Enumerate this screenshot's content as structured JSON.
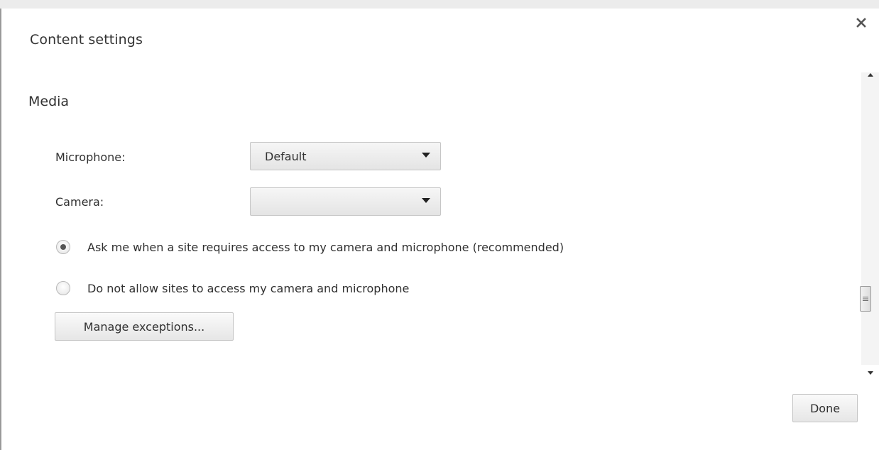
{
  "dialog": {
    "title": "Content settings",
    "close_icon": "close-icon"
  },
  "media": {
    "heading": "Media",
    "microphone": {
      "label": "Microphone:",
      "selected": "Default"
    },
    "camera": {
      "label": "Camera:",
      "selected": ""
    },
    "options": [
      {
        "label": "Ask me when a site requires access to my camera and microphone (recommended)",
        "checked": true
      },
      {
        "label": "Do not allow sites to access my camera and microphone",
        "checked": false
      }
    ],
    "manage_exceptions_label": "Manage exceptions..."
  },
  "footer": {
    "done_label": "Done"
  }
}
